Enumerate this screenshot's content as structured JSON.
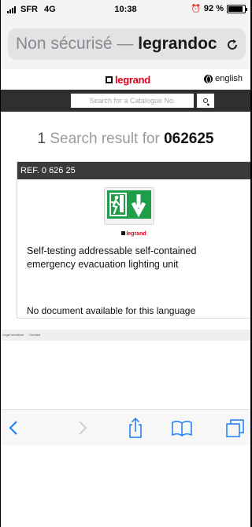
{
  "status_bar": {
    "carrier": "SFR",
    "network": "4G",
    "time": "10:38",
    "battery_percent": "92 %",
    "battery_level": 0.92
  },
  "address_bar": {
    "security_label": "Non sécurisé —",
    "domain": "legrandoc"
  },
  "site": {
    "logo_text": "legrand",
    "language_link": "english",
    "search": {
      "placeholder": "Search for a Catalogue No."
    }
  },
  "results": {
    "count": "1",
    "label": "Search result for",
    "query": "062625"
  },
  "product": {
    "reference": "REF. 0 626 25",
    "image_brand": "legrand",
    "description": "Self-testing addressable self-contained emergency evacuation lighting unit",
    "documents_notice": "No document available for this language"
  },
  "footer": {
    "links": [
      "Legal mentions",
      "Contact"
    ]
  },
  "toolbar": {
    "buttons": [
      "back-icon",
      "forward-icon",
      "share-icon",
      "bookmarks-icon",
      "tabs-icon"
    ]
  },
  "colors": {
    "brand": "#e2001a",
    "band": "#2f2f2f",
    "safari_blue": "#1a7cf5",
    "exit_green": "#1f9e4a"
  }
}
